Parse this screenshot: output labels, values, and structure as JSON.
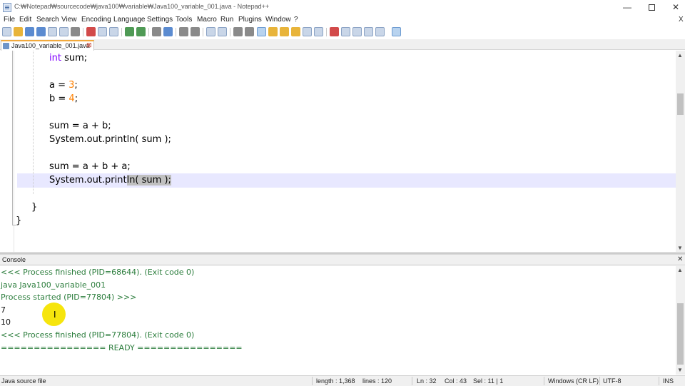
{
  "window": {
    "title": "C:₩Notepad₩sourcecode₩java100₩variable₩Java100_variable_001.java - Notepad++",
    "minimize_glyph": "—",
    "close_glyph": "✕"
  },
  "menubar": {
    "items": [
      "File",
      "Edit",
      "Search",
      "View",
      "Encoding",
      "Language",
      "Settings",
      "Tools",
      "Macro",
      "Run",
      "Plugins",
      "Window",
      "?"
    ],
    "doc_close": "X"
  },
  "toolbar": {
    "icons": [
      "new-file",
      "open-file",
      "save",
      "save-all",
      "close",
      "close-all",
      "print",
      "cut",
      "copy",
      "paste",
      "undo",
      "redo",
      "find",
      "replace",
      "zoom-in",
      "zoom-out",
      "sync-vertical",
      "sync-horizontal",
      "word-wrap",
      "show-all-characters",
      "indent-guide",
      "user-language",
      "document-map",
      "function-list",
      "folder-workspace",
      "monitoring",
      "record-macro",
      "stop-macro",
      "play-macro",
      "run-macro-multiple",
      "save-macro",
      "console"
    ]
  },
  "tab": {
    "label": "Java100_variable_001.java",
    "close_glyph": "⊠"
  },
  "editor": {
    "lines": [
      {
        "parts": [
          {
            "t": "int",
            "c": "kw"
          },
          {
            "t": " sum;",
            "c": ""
          }
        ]
      },
      {
        "parts": [
          {
            "t": "a = ",
            "c": ""
          },
          {
            "t": "3",
            "c": "num"
          },
          {
            "t": ";",
            "c": ""
          }
        ]
      },
      {
        "parts": [
          {
            "t": "b = ",
            "c": ""
          },
          {
            "t": "4",
            "c": "num"
          },
          {
            "t": ";",
            "c": ""
          }
        ]
      },
      {
        "parts": [
          {
            "t": "sum = a + b;",
            "c": ""
          }
        ]
      },
      {
        "parts": [
          {
            "t": "System.out.println( sum );",
            "c": ""
          }
        ]
      },
      {
        "parts": [
          {
            "t": "sum = a + b + a;",
            "c": ""
          }
        ]
      },
      {
        "parts": [
          {
            "t": "System.out.print",
            "c": ""
          },
          {
            "t": "ln( sum );",
            "c": "hl"
          }
        ]
      },
      {
        "parts": [
          {
            "t": "}",
            "c": ""
          }
        ]
      },
      {
        "parts": [
          {
            "t": "}",
            "c": ""
          }
        ]
      }
    ]
  },
  "console": {
    "title": "Console",
    "close_glyph": "✕",
    "lines": [
      {
        "text": "<<< Process finished (PID=68644). (Exit code 0)",
        "color": "green"
      },
      {
        "text": "java Java100_variable_001",
        "color": "green"
      },
      {
        "text": "Process started (PID=77804) >>>",
        "color": "green"
      },
      {
        "text": "7",
        "color": "black"
      },
      {
        "text": "10",
        "color": "black"
      },
      {
        "text": "<<< Process finished (PID=77804). (Exit code 0)",
        "color": "green"
      },
      {
        "text": "================ READY ================",
        "color": "green"
      }
    ]
  },
  "statusbar": {
    "file_type": "Java source file",
    "length": "length : 1,368",
    "lines": "lines : 120",
    "ln": "Ln : 32",
    "col": "Col : 43",
    "sel": "Sel : 11 | 1",
    "eol": "Windows (CR LF)",
    "encoding": "UTF-8",
    "mode": "INS"
  },
  "colors": {
    "keyword": "#8000ff",
    "number": "#ff8000",
    "console_green": "#2b7d3c",
    "current_line": "#e8e8ff",
    "selection": "#c0c0c0",
    "tab_accent": "#f2a93b"
  }
}
